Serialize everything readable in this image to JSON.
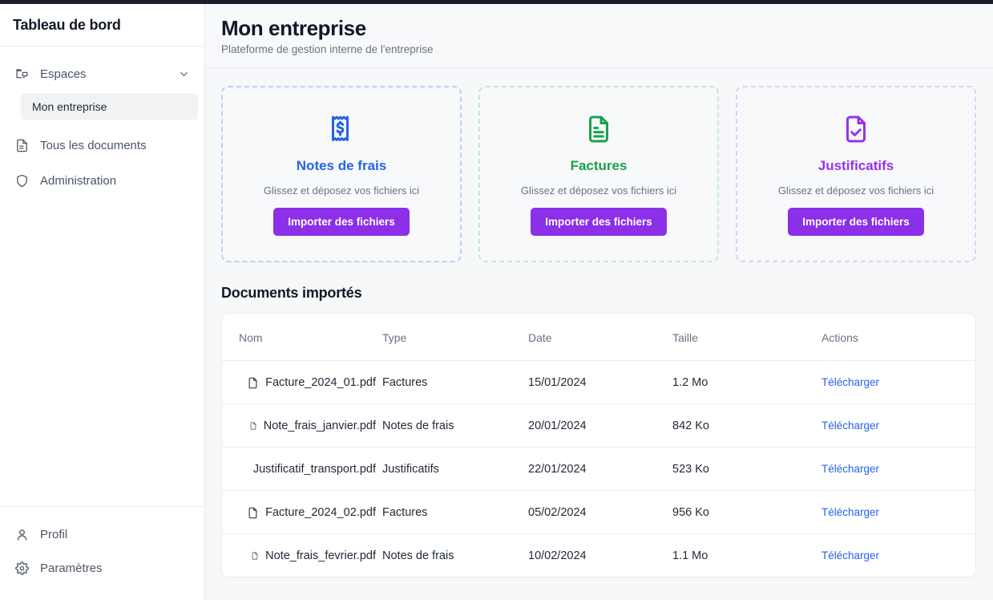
{
  "sidebar": {
    "title": "Tableau de bord",
    "group": {
      "icon": "spaces-icon",
      "label": "Espaces",
      "chevron": "chevron-down-icon",
      "children": [
        {
          "label": "Mon entreprise",
          "active": true
        }
      ]
    },
    "items": [
      {
        "icon": "document-icon",
        "label": "Tous les documents"
      },
      {
        "icon": "shield-icon",
        "label": "Administration"
      }
    ],
    "footer": [
      {
        "icon": "user-icon",
        "label": "Profil"
      },
      {
        "icon": "gear-icon",
        "label": "Paramètres"
      }
    ]
  },
  "header": {
    "title": "Mon entreprise",
    "subtitle": "Plateforme de gestion interne de l'entreprise"
  },
  "dropzones": [
    {
      "icon": "receipt-dollar-icon",
      "title": "Notes de frais",
      "hint": "Glissez et déposez vos fichiers ici",
      "button": "Importer des fichiers",
      "accent": "#2563eb",
      "border": "#bcd0f7"
    },
    {
      "icon": "document-lines-icon",
      "title": "Factures",
      "hint": "Glissez et déposez vos fichiers ici",
      "button": "Importer des fichiers",
      "accent": "#18a14b",
      "border": "#c3e9cf"
    },
    {
      "icon": "document-check-icon",
      "title": "Justificatifs",
      "hint": "Glissez et déposez vos fichiers ici",
      "button": "Importer des fichiers",
      "accent": "#9333ea",
      "border": "#e0cdf7"
    }
  ],
  "documents_section": {
    "title": "Documents importés",
    "columns": [
      "Nom",
      "Type",
      "Date",
      "Taille",
      "Actions"
    ],
    "rows": [
      {
        "icon": "file-icon",
        "name": "Facture_2024_01.pdf",
        "type": "Factures",
        "date": "15/01/2024",
        "size": "1.2 Mo",
        "action": "Télécharger"
      },
      {
        "icon": "file-icon",
        "name": "Note_frais_janvier.pdf",
        "type": "Notes de frais",
        "date": "20/01/2024",
        "size": "842 Ko",
        "action": "Télécharger"
      },
      {
        "icon": "file-icon",
        "name": "Justificatif_transport.pdf",
        "type": "Justificatifs",
        "date": "22/01/2024",
        "size": "523 Ko",
        "action": "Télécharger"
      },
      {
        "icon": "file-icon",
        "name": "Facture_2024_02.pdf",
        "type": "Factures",
        "date": "05/02/2024",
        "size": "956 Ko",
        "action": "Télécharger"
      },
      {
        "icon": "file-icon",
        "name": "Note_frais_fevrier.pdf",
        "type": "Notes de frais",
        "date": "10/02/2024",
        "size": "1.1 Mo",
        "action": "Télécharger"
      }
    ]
  },
  "colors": {
    "primary_button": "#8b2fe8",
    "link": "#2563eb",
    "topbar": "#1b1f2a"
  }
}
